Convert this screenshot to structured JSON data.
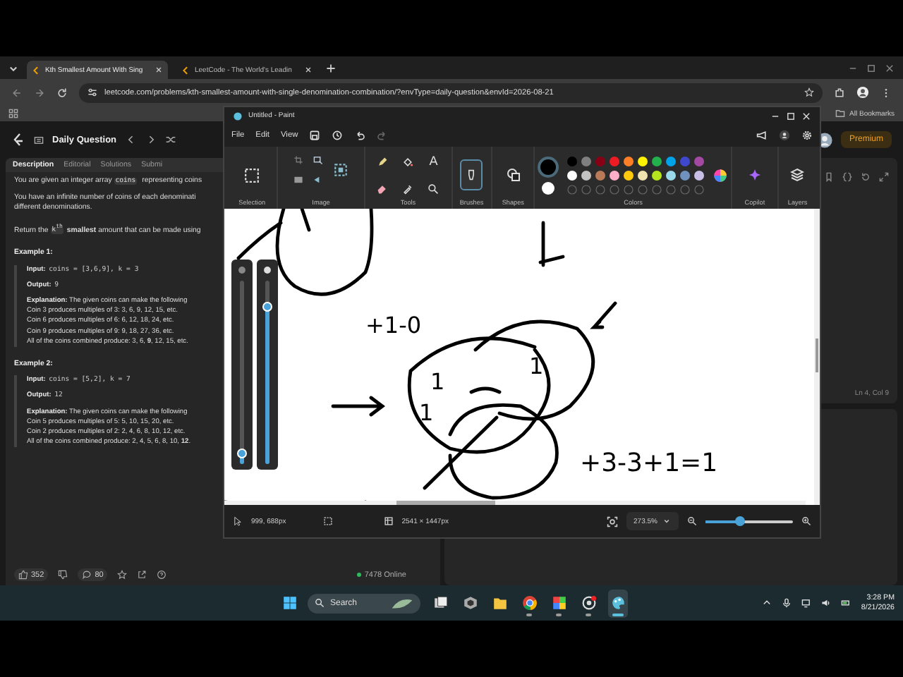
{
  "browser": {
    "tabs": [
      {
        "label": "Kth Smallest Amount With Sing",
        "selected": true
      },
      {
        "label": "LeetCode - The World's Leadin",
        "selected": false
      }
    ],
    "url": "leetcode.com/problems/kth-smallest-amount-with-single-denomination-combination/?envType=daily-question&envId=2026-08-21",
    "bookmarks": "All Bookmarks"
  },
  "leetcode": {
    "header_title": "Daily Question",
    "premium": "Premium",
    "tabs": [
      {
        "label": "Description",
        "selected": true
      },
      {
        "label": "Editorial",
        "selected": false
      },
      {
        "label": "Solutions",
        "selected": false
      },
      {
        "label": "Submi",
        "selected": false
      }
    ],
    "paragraphs": [
      [
        {
          "kind": "text",
          "text": "You are given an integer array "
        },
        {
          "kind": "code",
          "text": "coins"
        },
        {
          "kind": "text",
          "text": " representing coins"
        }
      ],
      [
        {
          "kind": "text",
          "text": "You have an infinite number of coins of each denominati different denominations."
        }
      ],
      [
        {
          "kind": "text",
          "text": "Return the "
        },
        {
          "kind": "code",
          "text": "k$^{th}$"
        },
        {
          "kind": "bold",
          "text": "smallest"
        },
        {
          "kind": "text",
          "text": " amount that can be made using"
        }
      ]
    ],
    "examples": [
      {
        "title": "Example 1:",
        "input_label": "Input:",
        "output_label": "Output:",
        "explanation_label": "Explanation:",
        "input": "coins = [3,6,9], k = 3",
        "output": "9",
        "explanation": "The given coins can make the following",
        "lines": [
          "Coin 3 produces multiples of 3: 3, 6, 9, 12, 15, etc.",
          "Coin 6 produces multiples of 6: 6, 12, 18, 24, etc.",
          "Coin 9 produces multiples of 9: 9, 18, 27, 36, etc.",
          "All of the coins combined produce: 3, 6, **9**, 12, 15, etc."
        ]
      },
      {
        "title": "Example 2:",
        "input_label": "Input:",
        "output_label": "Output:",
        "explanation_label": "Explanation:",
        "input": "coins = [5,2], k = 7",
        "output": "12",
        "explanation": "The given coins can make the following",
        "lines": [
          "Coin 5 produces multiples of 5: 5, 10, 15, 20, etc.",
          "Coin 2 produces multiples of 2: 2, 4, 6, 8, 10, 12, etc.",
          "All of the coins combined produce: 2, 4, 5, 6, 8, 10, **12**."
        ]
      }
    ],
    "likes": "352",
    "comments": "80",
    "online": "7478 Online",
    "editor_status": "Ln 4, Col 9"
  },
  "paint": {
    "title": "Untitled - Paint",
    "menus": [
      "File",
      "Edit",
      "View"
    ],
    "text_tool": "A",
    "groups": [
      "Selection",
      "Image",
      "Tools",
      "Brushes",
      "Shapes",
      "Colors",
      "Copilot",
      "Layers"
    ],
    "current_colors": [
      {
        "color": "#000000"
      },
      {
        "color": "#ffffff"
      }
    ],
    "palette": [
      {
        "color": "#000000"
      },
      {
        "color": "#7f7f7f"
      },
      {
        "color": "#880015"
      },
      {
        "color": "#ed1c24"
      },
      {
        "color": "#ff7f27"
      },
      {
        "color": "#fff200"
      },
      {
        "color": "#22b14c"
      },
      {
        "color": "#00a2e8"
      },
      {
        "color": "#3f48cc"
      },
      {
        "color": "#a349a4"
      },
      {
        "color": "#ffffff"
      },
      {
        "color": "#c3c3c3"
      },
      {
        "color": "#b97a57"
      },
      {
        "color": "#ffaec9"
      },
      {
        "color": "#ffc90e"
      },
      {
        "color": "#efe4b0"
      },
      {
        "color": "#b5e61d"
      },
      {
        "color": "#99d9ea"
      },
      {
        "color": "#7092be"
      },
      {
        "color": "#c8bfe7"
      }
    ],
    "sliders": [
      {
        "level": 0.06
      },
      {
        "level": 0.86
      }
    ],
    "sketch_texts": [
      "+1-0",
      "1",
      "1",
      "1",
      "+3-3+1=1"
    ],
    "cursor_position": "999, 688px",
    "canvas_size": "2541 × 1447px",
    "zoom": "273.5%",
    "zoom_slider": {
      "level": 0.4
    }
  },
  "taskbar": {
    "search": "Search",
    "apps": [
      {
        "kind": "squares",
        "open": false
      },
      {
        "kind": "cube",
        "open": false
      },
      {
        "kind": "folder",
        "open": false
      },
      {
        "kind": "browser",
        "open": true
      },
      {
        "kind": "grid",
        "open": true
      },
      {
        "kind": "record",
        "open": true
      },
      {
        "kind": "palette",
        "open": true,
        "selected": true
      }
    ],
    "time": "3:28 PM",
    "date": "8/21/2026"
  }
}
